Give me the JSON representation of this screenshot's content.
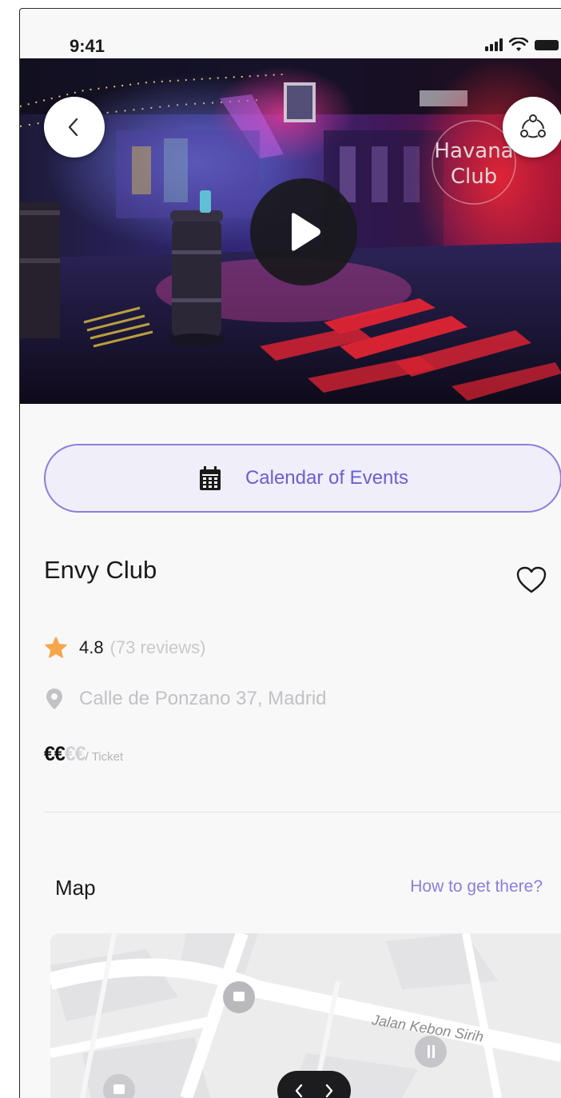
{
  "status_bar": {
    "time": "9:41"
  },
  "hero": {
    "sign_line1": "Havana",
    "sign_line2": "Club"
  },
  "calendar": {
    "label": "Calendar of Events"
  },
  "venue": {
    "name": "Envy Club",
    "rating": "4.8",
    "reviews": "(73 reviews)",
    "address": "Calle de Ponzano 37, Madrid",
    "price_active": "€€",
    "price_inactive": "€€",
    "price_unit": "/ Ticket"
  },
  "map": {
    "title": "Map",
    "directions_link": "How to get there?",
    "street_label": "Jalan Kebon Sirih"
  },
  "colors": {
    "accent": "#8a7fdc",
    "accent_text": "#6b5fd1",
    "star": "#f6a64b",
    "muted": "#c2c2c6"
  },
  "icons": [
    "back-icon",
    "share-icon",
    "play-icon",
    "calendar-icon",
    "heart-icon",
    "star-icon",
    "location-pin-icon",
    "signal-icon",
    "wifi-icon",
    "battery-icon"
  ]
}
